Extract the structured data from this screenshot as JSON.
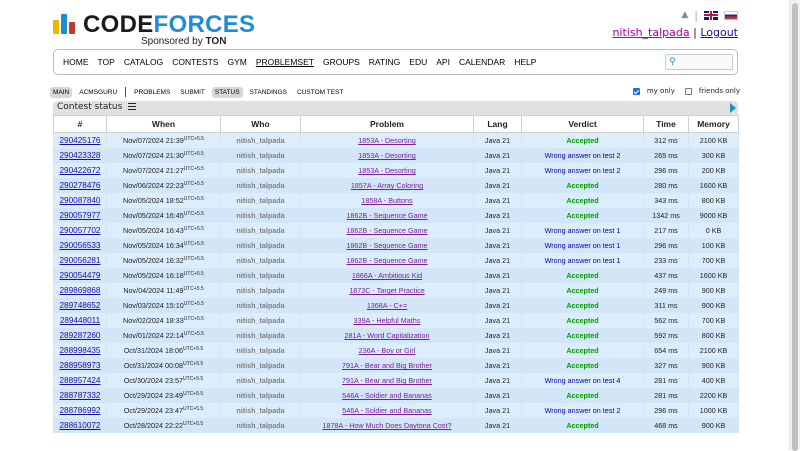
{
  "brand": {
    "word_main": "CODE",
    "word_accent": "FORCES",
    "sponsor_prefix": "Sponsored by",
    "sponsor_name": "TON",
    "bar_colors": [
      "#f2b400",
      "#1f8dd6",
      "#c0392b"
    ]
  },
  "header": {
    "separator_1": "|",
    "username": "nitish_talpada",
    "separator_2": "|",
    "logout": "Logout"
  },
  "menu": {
    "items": [
      "HOME",
      "TOP",
      "CATALOG",
      "CONTESTS",
      "GYM",
      "PROBLEMSET",
      "GROUPS",
      "RATING",
      "EDU",
      "API",
      "CALENDAR",
      "HELP"
    ],
    "active": "PROBLEMSET"
  },
  "submenu": {
    "group1": [
      "MAIN",
      "ACMSGURU"
    ],
    "group2": [
      "PROBLEMS",
      "SUBMIT",
      "STATUS",
      "STANDINGS",
      "CUSTOM TEST"
    ],
    "active": [
      "MAIN",
      "STATUS"
    ]
  },
  "filters": {
    "my_only": {
      "label": "my only",
      "checked": true
    },
    "friends_only": {
      "label": "friends only",
      "checked": false
    }
  },
  "status": {
    "title": "Contest status",
    "columns": [
      "#",
      "When",
      "Who",
      "Problem",
      "Lang",
      "Verdict",
      "Time",
      "Memory"
    ],
    "tz_suffix": "UTC+5.5",
    "rows": [
      {
        "id": "290425176",
        "when": "Nov/07/2024 21:39",
        "who": "nitish_talpada",
        "problem": "1853A - Desorting",
        "lang": "Java 21",
        "verdict": "Accepted",
        "time": "312 ms",
        "memory": "2100 KB"
      },
      {
        "id": "290423328",
        "when": "Nov/07/2024 21:30",
        "who": "nitish_talpada",
        "problem": "1853A - Desorting",
        "lang": "Java 21",
        "verdict": "Wrong answer on test 2",
        "time": "265 ms",
        "memory": "300 KB"
      },
      {
        "id": "290422672",
        "when": "Nov/07/2024 21:27",
        "who": "nitish_talpada",
        "problem": "1853A - Desorting",
        "lang": "Java 21",
        "verdict": "Wrong answer on test 2",
        "time": "296 ms",
        "memory": "200 KB"
      },
      {
        "id": "290278476",
        "when": "Nov/06/2024 22:23",
        "who": "nitish_talpada",
        "problem": "1857A - Array Coloring",
        "lang": "Java 21",
        "verdict": "Accepted",
        "time": "280 ms",
        "memory": "1600 KB"
      },
      {
        "id": "290087840",
        "when": "Nov/05/2024 18:52",
        "who": "nitish_talpada",
        "problem": "1858A - Buttons",
        "lang": "Java 21",
        "verdict": "Accepted",
        "time": "343 ms",
        "memory": "800 KB"
      },
      {
        "id": "290057977",
        "when": "Nov/05/2024 16:45",
        "who": "nitish_talpada",
        "problem": "1862B - Sequence Game",
        "lang": "Java 21",
        "verdict": "Accepted",
        "time": "1342 ms",
        "memory": "9000 KB"
      },
      {
        "id": "290057702",
        "when": "Nov/05/2024 16:43",
        "who": "nitish_talpada",
        "problem": "1862B - Sequence Game",
        "lang": "Java 21",
        "verdict": "Wrong answer on test 1",
        "time": "217 ms",
        "memory": "0 KB"
      },
      {
        "id": "290056533",
        "when": "Nov/05/2024 16:34",
        "who": "nitish_talpada",
        "problem": "1862B - Sequence Game",
        "lang": "Java 21",
        "verdict": "Wrong answer on test 1",
        "time": "296 ms",
        "memory": "100 KB"
      },
      {
        "id": "290056281",
        "when": "Nov/05/2024 16:32",
        "who": "nitish_talpada",
        "problem": "1862B - Sequence Game",
        "lang": "Java 21",
        "verdict": "Wrong answer on test 1",
        "time": "233 ms",
        "memory": "700 KB"
      },
      {
        "id": "290054479",
        "when": "Nov/05/2024 16:18",
        "who": "nitish_talpada",
        "problem": "1866A - Ambitious Kid",
        "lang": "Java 21",
        "verdict": "Accepted",
        "time": "437 ms",
        "memory": "1600 KB"
      },
      {
        "id": "289869868",
        "when": "Nov/04/2024 11:49",
        "who": "nitish_talpada",
        "problem": "1873C - Target Practice",
        "lang": "Java 21",
        "verdict": "Accepted",
        "time": "249 ms",
        "memory": "900 KB"
      },
      {
        "id": "289748652",
        "when": "Nov/03/2024 15:10",
        "who": "nitish_talpada",
        "problem": "1368A - C+=",
        "lang": "Java 21",
        "verdict": "Accepted",
        "time": "311 ms",
        "memory": "900 KB"
      },
      {
        "id": "289448011",
        "when": "Nov/02/2024 18:33",
        "who": "nitish_talpada",
        "problem": "339A - Helpful Maths",
        "lang": "Java 21",
        "verdict": "Accepted",
        "time": "562 ms",
        "memory": "700 KB"
      },
      {
        "id": "289287260",
        "when": "Nov/01/2024 22:14",
        "who": "nitish_talpada",
        "problem": "281A - Word Capitalization",
        "lang": "Java 21",
        "verdict": "Accepted",
        "time": "592 ms",
        "memory": "800 KB"
      },
      {
        "id": "288998435",
        "when": "Oct/31/2024 18:06",
        "who": "nitish_talpada",
        "problem": "236A - Boy or Girl",
        "lang": "Java 21",
        "verdict": "Accepted",
        "time": "654 ms",
        "memory": "2100 KB"
      },
      {
        "id": "288958973",
        "when": "Oct/31/2024 00:08",
        "who": "nitish_talpada",
        "problem": "791A - Bear and Big Brother",
        "lang": "Java 21",
        "verdict": "Accepted",
        "time": "327 ms",
        "memory": "900 KB"
      },
      {
        "id": "288957424",
        "when": "Oct/30/2024 23:57",
        "who": "nitish_talpada",
        "problem": "791A - Bear and Big Brother",
        "lang": "Java 21",
        "verdict": "Wrong answer on test 4",
        "time": "281 ms",
        "memory": "400 KB"
      },
      {
        "id": "288787332",
        "when": "Oct/29/2024 23:49",
        "who": "nitish_talpada",
        "problem": "546A - Soldier and Bananas",
        "lang": "Java 21",
        "verdict": "Accepted",
        "time": "281 ms",
        "memory": "2200 KB"
      },
      {
        "id": "288786992",
        "when": "Oct/29/2024 23:47",
        "who": "nitish_talpada",
        "problem": "546A - Soldier and Bananas",
        "lang": "Java 21",
        "verdict": "Wrong answer on test 2",
        "time": "296 ms",
        "memory": "1000 KB"
      },
      {
        "id": "288610072",
        "when": "Oct/28/2024 22:22",
        "who": "nitish_talpada",
        "problem": "1878A - How Much Does Daytona Cost?",
        "lang": "Java 21",
        "verdict": "Accepted",
        "time": "468 ms",
        "memory": "900 KB"
      }
    ]
  }
}
